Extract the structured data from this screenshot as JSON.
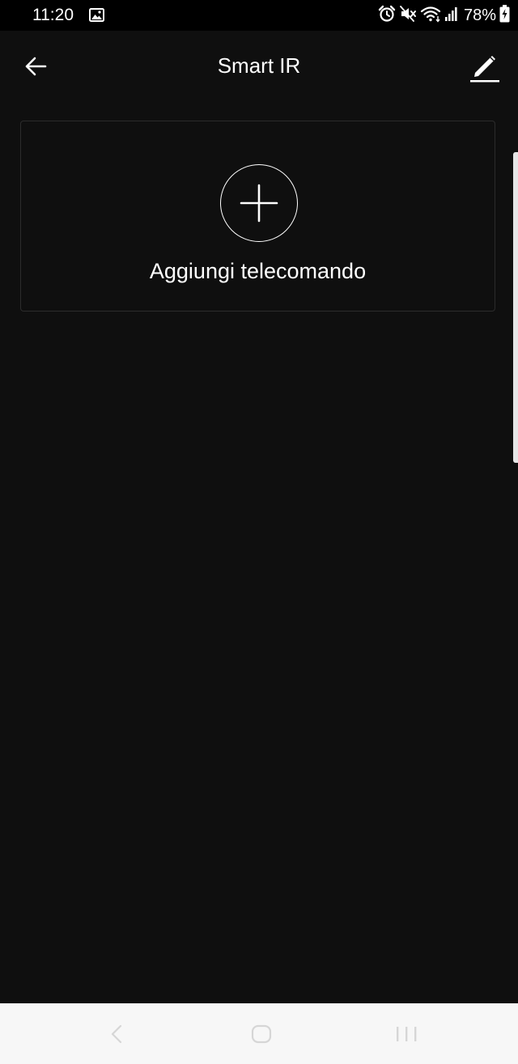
{
  "status_bar": {
    "time": "11:20",
    "battery_percent": "78%",
    "icons": [
      "gallery-icon",
      "alarm-icon",
      "mute-icon",
      "wifi-icon",
      "signal-icon",
      "battery-charging-icon"
    ]
  },
  "app_bar": {
    "title": "Smart IR",
    "back_icon": "arrow-left-icon",
    "edit_icon": "pencil-icon"
  },
  "add_remote_card": {
    "label": "Aggiungi telecomando",
    "icon": "plus-icon"
  },
  "nav_bar": {
    "buttons": [
      "back",
      "home",
      "recents"
    ]
  },
  "colors": {
    "background": "#0f0f0f",
    "status_bar": "#000000",
    "text": "#ffffff",
    "card_border": "#2c2c2c",
    "nav_bar": "#f7f7f7",
    "nav_icons": "#d6d6d6"
  }
}
